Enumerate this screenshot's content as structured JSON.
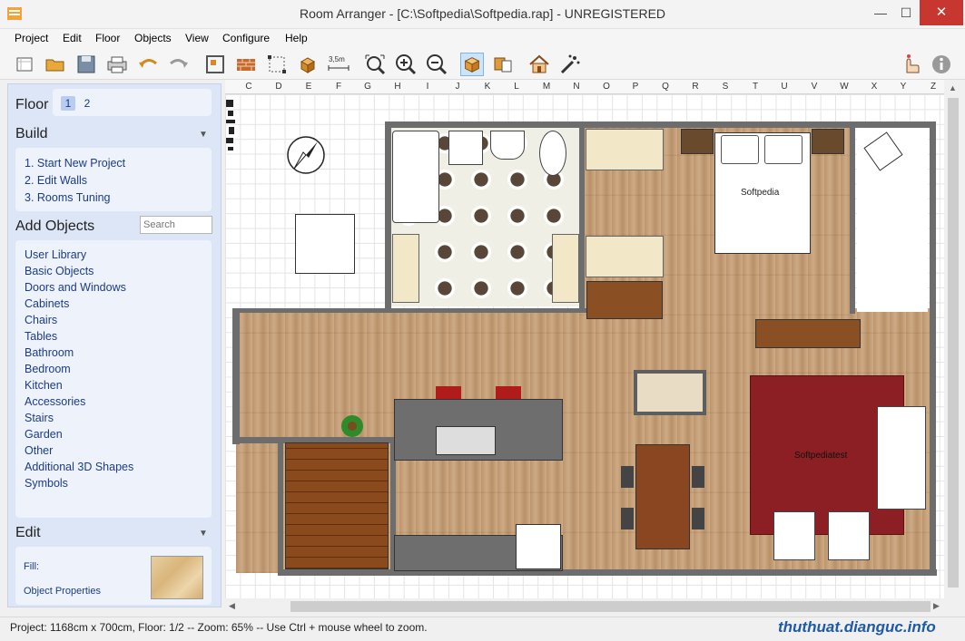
{
  "window": {
    "title": "Room Arranger - [C:\\Softpedia\\Softpedia.rap] - UNREGISTERED",
    "min_glyph": "—",
    "max_glyph": "☐",
    "close_glyph": "✕"
  },
  "menu": [
    "Project",
    "Edit",
    "Floor",
    "Objects",
    "View",
    "Configure",
    "Help"
  ],
  "toolbar": {
    "icons": [
      "new-project-icon",
      "open-folder-icon",
      "save-icon",
      "print-icon",
      "undo-icon",
      "redo-icon",
      "edit-walls-icon",
      "brick-wall-icon",
      "select-area-icon",
      "objects-icon",
      "measure-icon",
      "zoom-fit-icon",
      "zoom-in-icon",
      "zoom-out-icon",
      "3d-box-icon",
      "3d-view-icon",
      "house-icon",
      "magic-icon",
      "hand-icon",
      "info-icon"
    ],
    "measure_label": "3,5m"
  },
  "sidebar": {
    "floor_title": "Floor",
    "floors": [
      "1",
      "2"
    ],
    "selected_floor": "1",
    "build_title": "Build",
    "build_items": [
      "1. Start New Project",
      "2. Edit Walls",
      "3. Rooms Tuning"
    ],
    "add_objects_title": "Add Objects",
    "search_placeholder": "Search",
    "object_categories": [
      "User Library",
      "Basic Objects",
      "Doors and Windows",
      "Cabinets",
      "Chairs",
      "Tables",
      "Bathroom",
      "Bedroom",
      "Kitchen",
      "Accessories",
      "Stairs",
      "Garden",
      "Other",
      "Additional 3D Shapes",
      "Symbols"
    ],
    "edit_title": "Edit",
    "fill_label": "Fill:",
    "object_properties_label": "Object Properties",
    "collapse_glyph": "▼"
  },
  "ruler": {
    "columns": [
      "C",
      "D",
      "E",
      "F",
      "G",
      "H",
      "I",
      "J",
      "K",
      "L",
      "M",
      "N",
      "O",
      "P",
      "Q",
      "R",
      "S",
      "T",
      "U",
      "V",
      "W",
      "X",
      "Y",
      "Z"
    ]
  },
  "plan": {
    "bed_label": "Softpedia",
    "rug_label": "Softpediatest"
  },
  "statusbar": {
    "text": "Project: 1168cm x 700cm, Floor: 1/2 -- Zoom: 65% -- Use Ctrl + mouse wheel to zoom."
  },
  "watermark": "thuthuat.dianguc.info",
  "colors": {
    "sidebar_bg": "#dde6f6",
    "link": "#1b3c87",
    "close_button": "#c7372f",
    "wall": "#6d6d6d",
    "rug": "#8b1f24"
  }
}
